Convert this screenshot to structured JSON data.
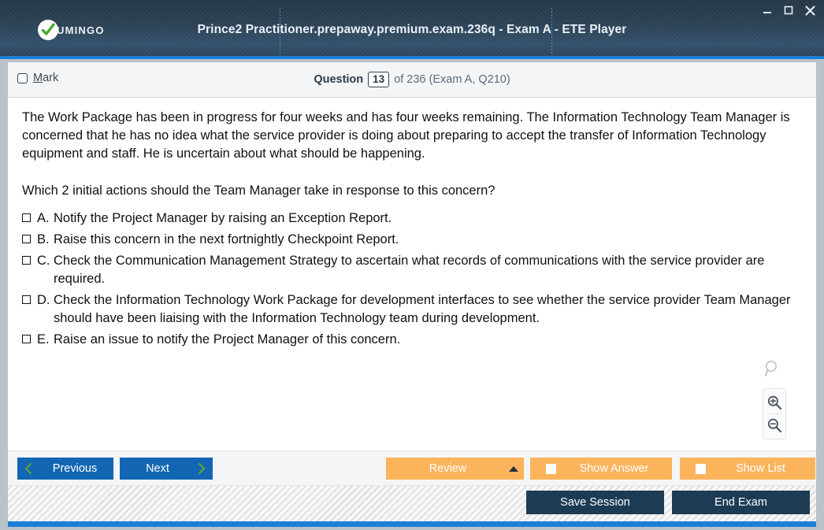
{
  "window": {
    "logo_text": "UMINGO",
    "logo_icon": "check-circle-icon",
    "title": "Prince2 Practitioner.prepaway.premium.exam.236q - Exam A - ETE Player",
    "controls": {
      "minimize": "minimize-icon",
      "maximize": "maximize-icon",
      "close": "close-icon"
    },
    "accent_blue": "#1b7fd4",
    "titlebar_dark": "#2b4154"
  },
  "header": {
    "mark_accel": "M",
    "mark_label_rest": "ark",
    "question_word": "Question",
    "question_number": "13",
    "question_rest": "of 236 (Exam A, Q210)"
  },
  "question": {
    "body": "The Work Package has been in progress for four weeks and has four weeks remaining. The Information Technology Team Manager is concerned that he has no idea what the service provider is doing about preparing to accept the transfer of Information Technology equipment and staff. He is uncertain about what should be happening.",
    "prompt": "Which 2 initial actions should the Team Manager take in response to this concern?",
    "options": [
      {
        "letter": "A.",
        "text": "Notify the Project Manager by raising an Exception Report.",
        "checked": false
      },
      {
        "letter": "B.",
        "text": "Raise this concern in the next fortnightly Checkpoint Report.",
        "checked": false
      },
      {
        "letter": "C.",
        "text": "Check the Communication Management Strategy to ascertain what records of communications with the service provider are required.",
        "checked": false
      },
      {
        "letter": "D.",
        "text": "Check the Information Technology Work Package for development interfaces to see whether the service provider Team Manager should have been liaising with the Information Technology team during development.",
        "checked": false
      },
      {
        "letter": "E.",
        "text": "Raise an issue to notify the Project Manager of this concern.",
        "checked": false
      }
    ]
  },
  "zoom_controls": {
    "search_icon": "magnifier-icon",
    "zoom_in_icon": "magnifier-plus-icon",
    "zoom_out_icon": "magnifier-minus-icon"
  },
  "navbar": {
    "previous_label": "Previous",
    "next_label": "Next",
    "review_label": "Review",
    "show_answer_label": "Show Answer",
    "show_list_label": "Show List",
    "button_blue": "#1266b3",
    "button_orange": "#fbb45c",
    "chevron_green": "#5aa832"
  },
  "footer": {
    "save_session_label": "Save Session",
    "end_exam_label": "End Exam",
    "button_dark": "#1d3c54"
  }
}
